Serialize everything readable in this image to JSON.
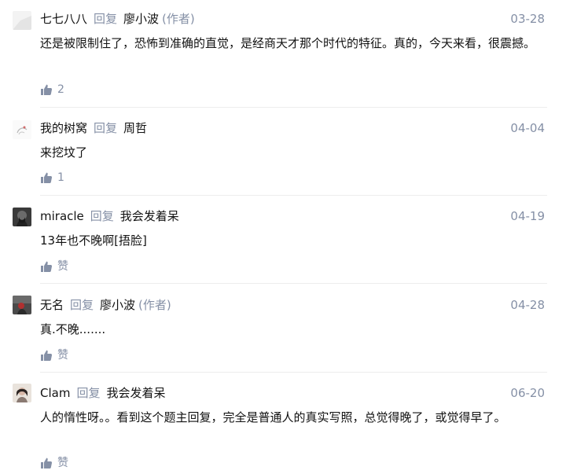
{
  "comments": [
    {
      "user": "七七八八",
      "reply_label": "回复",
      "reply_to": "廖小波",
      "author_tag": "(作者)",
      "date": "03-28",
      "text": "还是被限制住了，恐怖到准确的直觉，是经商天才那个时代的特征。真的，今天来看，很震撼。",
      "likes": "2"
    },
    {
      "user": "我的树窝",
      "reply_label": "回复",
      "reply_to": "周哲",
      "date": "04-04",
      "text": "来挖坟了",
      "likes": "1"
    },
    {
      "user": "miracle",
      "reply_label": "回复",
      "reply_to": "我会发着呆",
      "date": "04-19",
      "text": "13年也不晚啊[捂脸]",
      "likes": "赞"
    },
    {
      "user": "无名",
      "reply_label": "回复",
      "reply_to": "廖小波",
      "author_tag": "(作者)",
      "date": "04-28",
      "text": "真.不晚.......",
      "likes": "赞"
    },
    {
      "user": "Clam",
      "reply_label": "回复",
      "reply_to": "我会发着呆",
      "date": "06-20",
      "text": "人的惰性呀。。看到这个题主回复，完全是普通人的真实写照，总觉得晚了，或觉得早了。",
      "likes": "赞"
    }
  ],
  "colors": {
    "muted": "#8590a6",
    "text": "#121212",
    "divider": "#ededed"
  },
  "icons": {
    "like": "thumbs-up-icon"
  }
}
